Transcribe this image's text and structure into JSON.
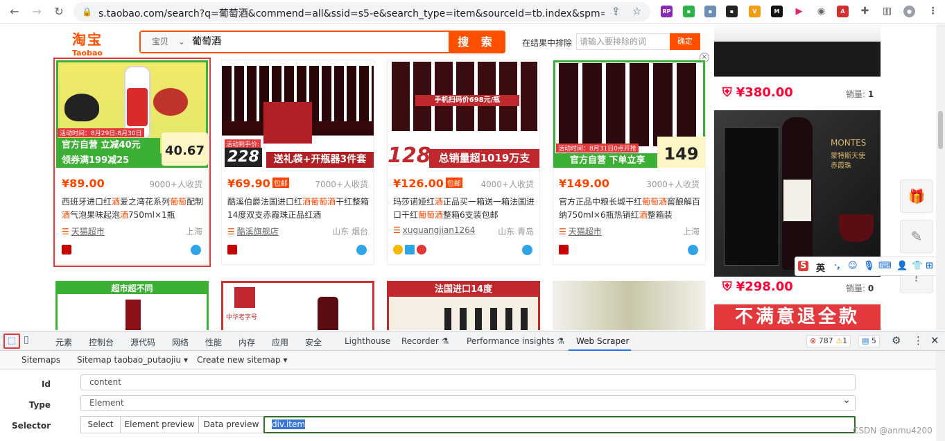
{
  "browser": {
    "url": "s.taobao.com/search?q=葡萄酒&commend=all&ssid=s5-e&search_type=item&sourceId=tb.index&spm=a..."
  },
  "header": {
    "logo_cn": "淘宝",
    "logo_en": "Taobao",
    "category": "宝贝",
    "query": "葡萄酒",
    "search_btn": "搜 索",
    "exclude_label": "在结果中排除",
    "exclude_placeholder": "请输入要排除的词",
    "exclude_btn": "确定"
  },
  "products": [
    {
      "price": "¥89.00",
      "tag": "",
      "deals": "9000+人收货",
      "title_html": "西班牙进口红<span class='hit'>酒</span>爱之湾花系列<span class='hit'>葡萄</span>配制<span class='hit'>酒</span>气泡果味起泡<span class='hit'>酒</span>750ml×1瓶",
      "shop": "天猫超市",
      "location": "上海",
      "img_banner": "官方自营 立减40元",
      "img_banner2": "领券满199减25",
      "img_price": "40.67",
      "img_event": "活动时间：8月29日-8月30日"
    },
    {
      "price": "¥69.90",
      "tag": "包邮",
      "deals": "7000+人收货",
      "title_html": "酷溪伯爵法国进口红<span class='hit'>酒葡萄酒</span>干红整箱14度双支赤霞珠正品红酒",
      "shop": "酷溪旗舰店",
      "location": "山东 烟台",
      "img_banner": "送礼袋+开瓶器3件套",
      "img_price": "228",
      "img_event": "活动到手价:"
    },
    {
      "price": "¥126.00",
      "tag": "包邮",
      "deals": "4000+人收货",
      "title_html": "玛莎诺娅红<span class='hit'>酒</span>正品买一箱送一箱法国进口干红<span class='hit'>葡萄酒</span>整箱6支装包邮",
      "shop": "xuguangjian1264",
      "location": "山东 青岛",
      "img_banner": "总销量超1019万支",
      "img_price": "128",
      "img_event": "手机扫码价698元/瓶"
    },
    {
      "price": "¥149.00",
      "tag": "",
      "deals": "3000+人收货",
      "title_html": "官方正品中粮长城干红<span class='hit'>葡萄酒</span>窖酿解百纳750ml×6瓶热销红<span class='hit'>酒</span>整箱装",
      "shop": "天猫超市",
      "location": "上海",
      "img_banner": "官方自营 下单立享",
      "img_price": "149",
      "img_event": "活动时间：8月31日0点开抢"
    }
  ],
  "row2": [
    {
      "label": "超市超不同"
    },
    {
      "label": "中华老字号"
    },
    {
      "label": "法国进口14度"
    },
    {
      "label": ""
    }
  ],
  "right": {
    "p1_price": "¥380.00",
    "p1_sold_label": "销量:",
    "p1_sold": "1",
    "p2_price": "¥298.00",
    "p2_sold_label": "销量:",
    "p2_sold": "0",
    "p2_brand": "MONTES",
    "p2_brand_cn": "蒙特斯天使赤霞珠",
    "banner": "不满意退全款"
  },
  "ime": {
    "label": "英"
  },
  "devtools": {
    "tabs": [
      "元素",
      "控制台",
      "源代码",
      "网络",
      "性能",
      "内存",
      "应用",
      "安全",
      "Lighthouse",
      "Recorder",
      "Performance insights",
      "Web Scraper"
    ],
    "errors": "787",
    "warnings": "1",
    "messages": "5"
  },
  "scraper": {
    "nav": [
      "Sitemaps",
      "Sitemap taobao_putaojiu",
      "Create new sitemap"
    ],
    "id_label": "Id",
    "id_value": "content",
    "type_label": "Type",
    "type_value": "Element",
    "selector_label": "Selector",
    "btn_select": "Select",
    "btn_element_preview": "Element preview",
    "btn_data_preview": "Data preview",
    "selector_value": "div.item"
  },
  "watermark": "CSDN @anmu4200"
}
